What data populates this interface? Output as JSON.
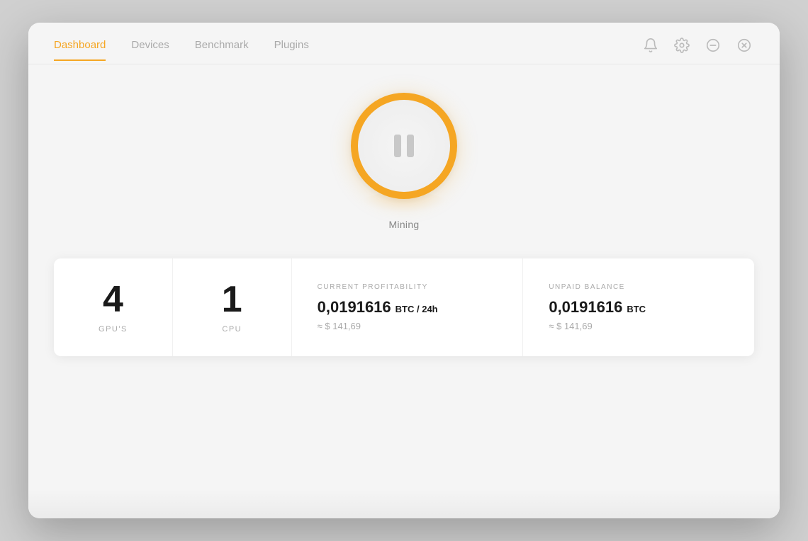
{
  "nav": {
    "links": [
      {
        "id": "dashboard",
        "label": "Dashboard",
        "active": true
      },
      {
        "id": "devices",
        "label": "Devices",
        "active": false
      },
      {
        "id": "benchmark",
        "label": "Benchmark",
        "active": false
      },
      {
        "id": "plugins",
        "label": "Plugins",
        "active": false
      }
    ],
    "icons": [
      {
        "id": "bell",
        "label": "Notifications"
      },
      {
        "id": "gear",
        "label": "Settings"
      },
      {
        "id": "minimize",
        "label": "Minimize"
      },
      {
        "id": "close",
        "label": "Close"
      }
    ]
  },
  "mining": {
    "button_label": "Mining",
    "state": "paused"
  },
  "stats": {
    "gpu_count": "4",
    "gpu_label": "GPU'S",
    "cpu_count": "1",
    "cpu_label": "CPU",
    "profitability": {
      "header": "CURRENT PROFITABILITY",
      "btc_value": "0,0191616",
      "btc_unit": "BTC / 24h",
      "usd_value": "≈ $ 141,69"
    },
    "balance": {
      "header": "UNPAID BALANCE",
      "btc_value": "0,0191616",
      "btc_unit": "BTC",
      "usd_value": "≈ $ 141,69"
    }
  }
}
